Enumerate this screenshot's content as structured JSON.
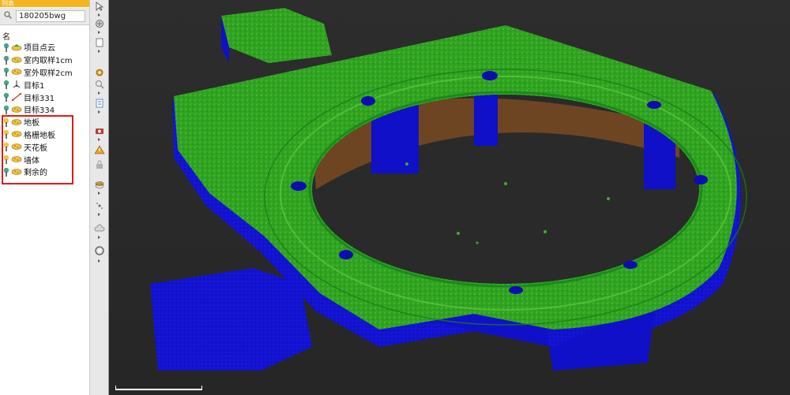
{
  "panel": {
    "header_title": "列表",
    "search_value": "180205bwg",
    "column_label": "名",
    "items": [
      {
        "label": "项目点云",
        "type": "project-cloud"
      },
      {
        "label": "室内取样1cm",
        "type": "cloud"
      },
      {
        "label": "室外取样2cm",
        "type": "cloud"
      },
      {
        "label": "目标1",
        "type": "target"
      },
      {
        "label": "目标331",
        "type": "target-line"
      },
      {
        "label": "目标334",
        "type": "cloud"
      },
      {
        "label": "地板",
        "type": "cloud"
      },
      {
        "label": "格栅地板",
        "type": "cloud"
      },
      {
        "label": "天花板",
        "type": "cloud"
      },
      {
        "label": "墙体",
        "type": "cloud"
      },
      {
        "label": "剩余的",
        "type": "cloud"
      }
    ]
  },
  "colors": {
    "accent": "#f3b61f",
    "highlight": "#e01a1a",
    "floor_green": "#3fae2a",
    "wall_blue": "#1010d8",
    "ceiling_brown": "#7a4a22"
  },
  "toolbar": {
    "tools": [
      "cursor-icon",
      "pan-icon",
      "rotate-icon",
      "page-icon",
      "gear-icon",
      "zoom-icon",
      "target-icon",
      "document-icon",
      "camera-icon",
      "warning-icon",
      "lock-icon",
      "stack-icon",
      "snap-icon",
      "cloud-icon",
      "sphere-icon"
    ]
  }
}
